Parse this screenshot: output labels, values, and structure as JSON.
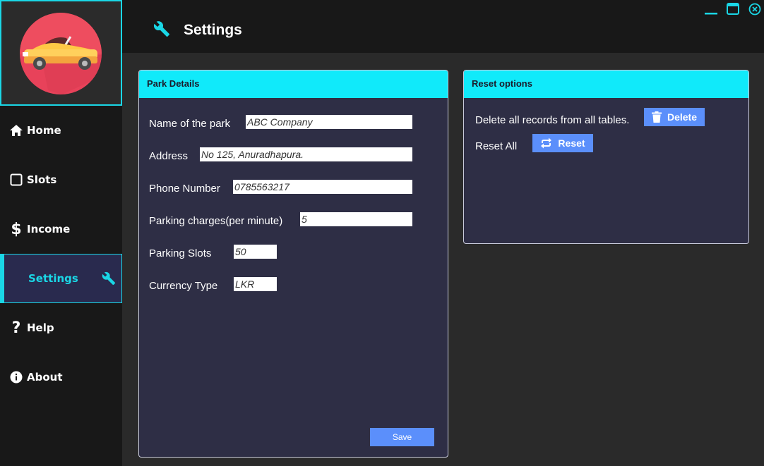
{
  "app": {
    "page_title": "Settings"
  },
  "colors": {
    "accent": "#1ad7e6",
    "panel_header": "#10eafa",
    "button": "#5b8ffb",
    "panel_bg": "#2e2e45"
  },
  "sidebar": {
    "items": [
      {
        "label": "Home",
        "icon": "home-icon"
      },
      {
        "label": "Slots",
        "icon": "square-icon"
      },
      {
        "label": "Income",
        "icon": "dollar-icon"
      },
      {
        "label": "Settings",
        "icon": "wrench-icon",
        "active": true
      },
      {
        "label": "Help",
        "icon": "question-icon"
      },
      {
        "label": "About",
        "icon": "info-icon"
      }
    ]
  },
  "park_details": {
    "title": "Park Details",
    "fields": [
      {
        "label": "Name of the park",
        "value": "ABC Company"
      },
      {
        "label": "Address",
        "value": "No 125, Anuradhapura."
      },
      {
        "label": "Phone Number",
        "value": "0785563217"
      },
      {
        "label": "Parking charges(per minute)",
        "value": "5"
      },
      {
        "label": "Parking Slots",
        "value": "50"
      },
      {
        "label": "Currency Type",
        "value": "LKR"
      }
    ],
    "save_label": "Save"
  },
  "reset_options": {
    "title": "Reset options",
    "delete_text": "Delete all records from all tables.",
    "delete_label": "Delete",
    "reset_text": "Reset All",
    "reset_label": "Reset"
  }
}
